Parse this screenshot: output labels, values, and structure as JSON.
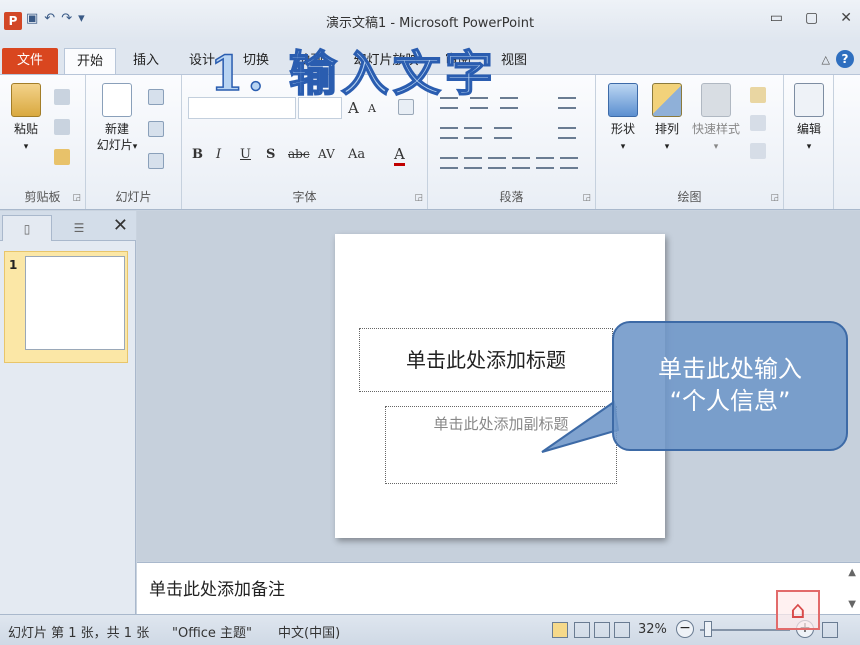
{
  "window": {
    "title": "演示文稿1 - Microsoft PowerPoint",
    "app_icon": "P"
  },
  "qat": {
    "save_icon": "save-icon",
    "undo_icon": "undo-icon",
    "redo_icon": "redo-icon",
    "customize": "▾"
  },
  "tabs": [
    {
      "label": "文件"
    },
    {
      "label": "开始"
    },
    {
      "label": "插入"
    },
    {
      "label": "设计"
    },
    {
      "label": "切换"
    },
    {
      "label": "动画"
    },
    {
      "label": "幻灯片放映"
    },
    {
      "label": "审阅"
    },
    {
      "label": "视图"
    }
  ],
  "overlay_title": "1. 输入文字",
  "ribbon": {
    "clipboard": {
      "label": "剪贴板",
      "paste": "粘贴"
    },
    "slides": {
      "label": "幻灯片",
      "new_slide_line1": "新建",
      "new_slide_line2": "幻灯片"
    },
    "font": {
      "label": "字体",
      "bold": "B",
      "italic": "I",
      "underline": "U",
      "shadow": "S",
      "strike": "abc",
      "spacing": "AV",
      "case": "Aa",
      "color": "A",
      "grow": "A",
      "shrink": "A"
    },
    "paragraph": {
      "label": "段落"
    },
    "drawing": {
      "label": "绘图",
      "shapes": "形状",
      "arrange": "排列",
      "quick_styles": "快速样式"
    },
    "editing": {
      "label": "编辑"
    }
  },
  "left_panel": {
    "close": "✕",
    "slide_number": "1"
  },
  "slide": {
    "title_placeholder": "单击此处添加标题",
    "subtitle_placeholder": "单击此处添加副标题"
  },
  "callout": {
    "line1": "单击此处输入",
    "line2": "“个人信息”"
  },
  "notes": {
    "placeholder": "单击此处添加备注"
  },
  "status": {
    "slide_info": "幻灯片 第 1 张，共 1 张",
    "theme": "\"Office 主题\"",
    "language": "中文(中国)",
    "zoom": "32%"
  },
  "colors": {
    "file_tab": "#d9461f",
    "callout": "#6e96c8",
    "accent": "#2a5db0"
  }
}
